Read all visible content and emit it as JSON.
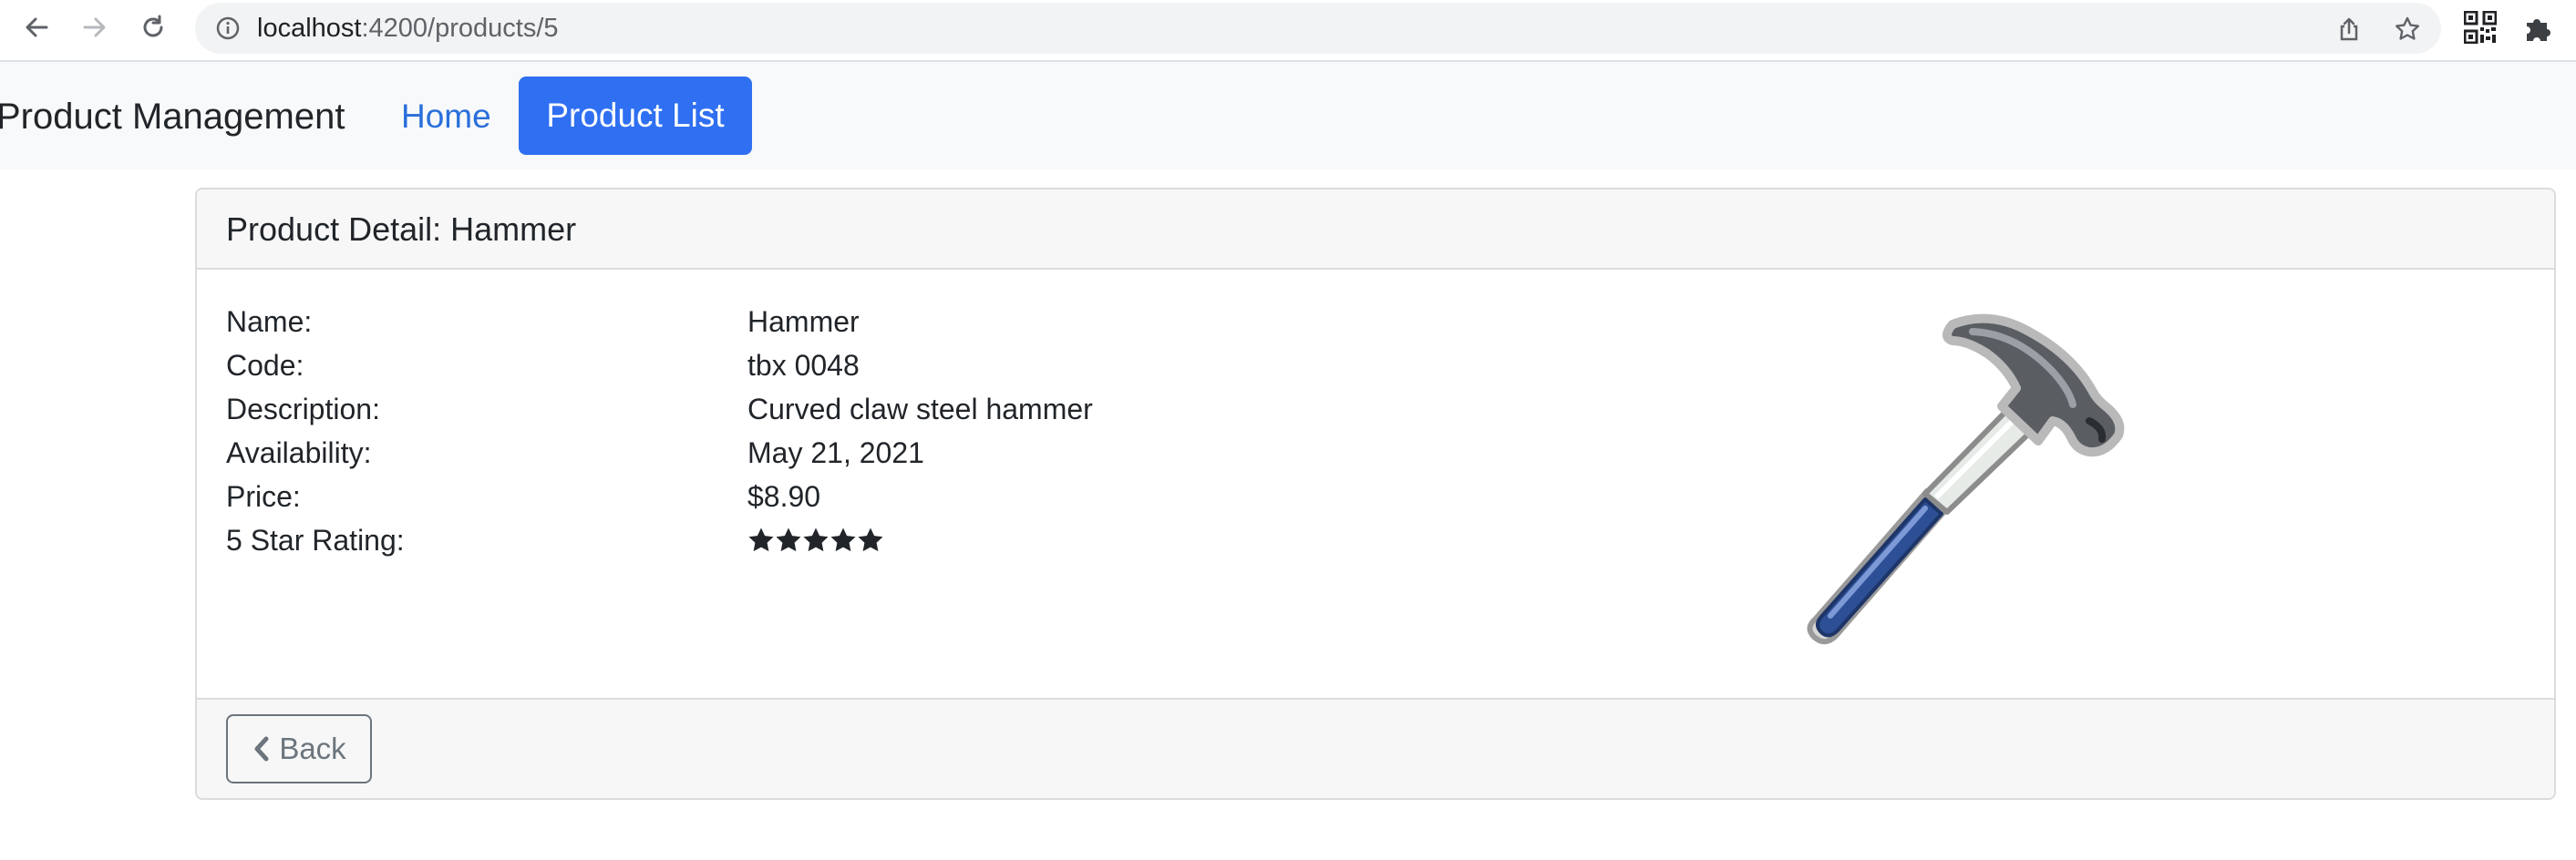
{
  "browser": {
    "url_host": "localhost",
    "url_path": ":4200/products/5"
  },
  "navbar": {
    "brand": "Product Management",
    "links": [
      {
        "label": "Home"
      },
      {
        "label": "Product List"
      }
    ]
  },
  "detail": {
    "header": "Product Detail: Hammer",
    "fields": [
      {
        "label": "Name:",
        "value": "Hammer"
      },
      {
        "label": "Code:",
        "value": "tbx 0048"
      },
      {
        "label": "Description:",
        "value": "Curved claw steel hammer"
      },
      {
        "label": "Availability:",
        "value": "May 21, 2021"
      },
      {
        "label": "Price:",
        "value": "$8.90"
      },
      {
        "label": "5 Star Rating:",
        "value": ""
      }
    ],
    "rating": 5,
    "back_label": "Back"
  },
  "colors": {
    "accent": "#2f6ff1",
    "link": "#2a6fdb",
    "hammer_handle": "#2c4f96"
  }
}
